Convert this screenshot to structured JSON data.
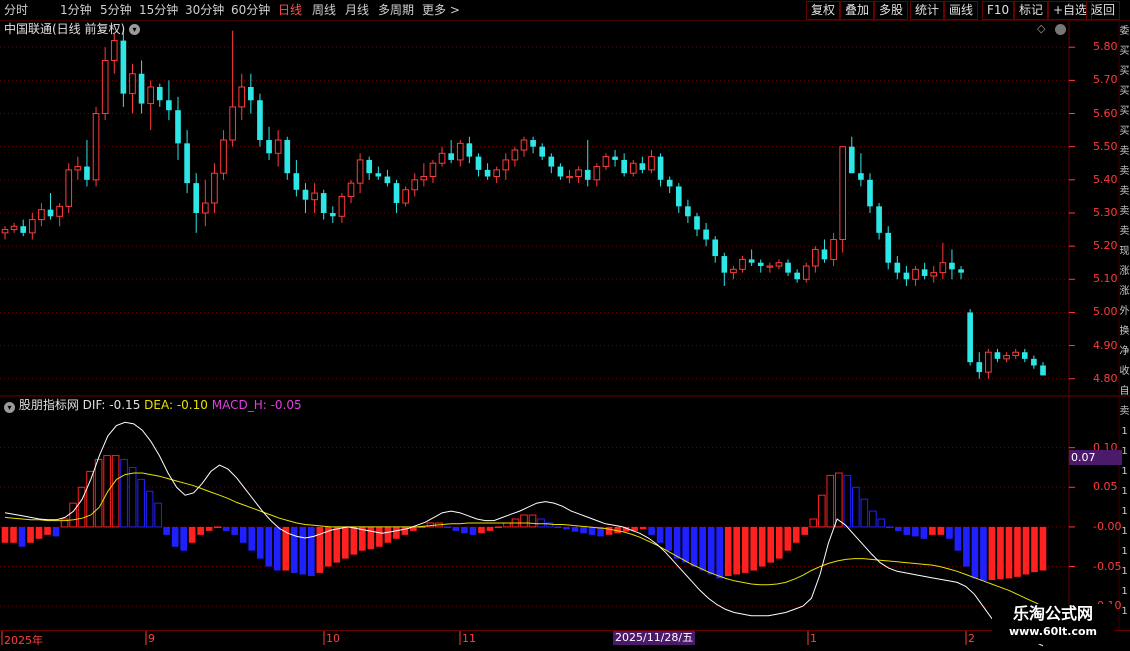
{
  "toolbar": {
    "periods": [
      "分时",
      "1分钟",
      "5分钟",
      "15分钟",
      "30分钟",
      "60分钟",
      "日线",
      "周线",
      "月线",
      "多周期",
      "更多 >"
    ],
    "active_period": "日线",
    "right_buttons": [
      "复权",
      "叠加",
      "多股",
      "统计",
      "画线",
      "F10",
      "标记",
      "+自选",
      "返回"
    ]
  },
  "stock": {
    "title": "中国联通(日线 前复权)"
  },
  "indicator": {
    "name": "股朋指标网",
    "dif_label": "DIF: -0.15",
    "dea_label": "DEA: -0.10",
    "macd_label": "MACD_H: -0.05",
    "current_value": "0.07"
  },
  "price_axis": {
    "ticks": [
      "5.80",
      "5.70",
      "5.60",
      "5.50",
      "5.40",
      "5.30",
      "5.20",
      "5.10",
      "5.00",
      "4.90",
      "4.80"
    ]
  },
  "macd_axis": {
    "ticks": [
      "0.10",
      "0.05",
      "-0.00",
      "-0.05",
      "-0.10"
    ]
  },
  "x_axis": {
    "labels": [
      "2025年",
      "9",
      "10",
      "11",
      "1",
      "2"
    ],
    "cursor_date": "2025/11/28/五"
  },
  "right_strip_chars": [
    "委",
    "买",
    "买",
    "买",
    "买",
    "买",
    "卖",
    "卖",
    "卖",
    "卖",
    "卖",
    "现",
    "涨",
    "涨",
    "外",
    "换",
    "净",
    "收",
    "自",
    "卖",
    "1",
    "1",
    "1",
    "1",
    "1",
    "1",
    "1",
    "1",
    "1",
    "1"
  ],
  "watermark": {
    "line1": "乐淘公式网",
    "line2": "www.60lt.com"
  },
  "colors": {
    "up": "#ff3b3b",
    "down": "#2de6e6",
    "macd_pos": "#ff2020",
    "macd_neg": "#2020ff",
    "dif": "#ffffff",
    "dea": "#e8e000",
    "grid": "#6a0000"
  },
  "chart_data": {
    "type": "candlestick",
    "price_range": [
      4.76,
      5.87
    ],
    "candles": [
      [
        5.24,
        5.26,
        5.22,
        5.25
      ],
      [
        5.25,
        5.27,
        5.24,
        5.26
      ],
      [
        5.26,
        5.28,
        5.23,
        5.24
      ],
      [
        5.24,
        5.3,
        5.22,
        5.28
      ],
      [
        5.28,
        5.33,
        5.26,
        5.31
      ],
      [
        5.31,
        5.36,
        5.28,
        5.29
      ],
      [
        5.29,
        5.33,
        5.26,
        5.32
      ],
      [
        5.32,
        5.45,
        5.3,
        5.43
      ],
      [
        5.43,
        5.47,
        5.4,
        5.44
      ],
      [
        5.44,
        5.52,
        5.38,
        5.4
      ],
      [
        5.4,
        5.62,
        5.38,
        5.6
      ],
      [
        5.6,
        5.8,
        5.58,
        5.76
      ],
      [
        5.76,
        5.84,
        5.72,
        5.82
      ],
      [
        5.82,
        5.85,
        5.62,
        5.66
      ],
      [
        5.66,
        5.75,
        5.6,
        5.72
      ],
      [
        5.72,
        5.76,
        5.6,
        5.63
      ],
      [
        5.63,
        5.7,
        5.55,
        5.68
      ],
      [
        5.68,
        5.69,
        5.62,
        5.64
      ],
      [
        5.64,
        5.7,
        5.58,
        5.61
      ],
      [
        5.61,
        5.65,
        5.46,
        5.51
      ],
      [
        5.51,
        5.55,
        5.36,
        5.39
      ],
      [
        5.39,
        5.42,
        5.24,
        5.3
      ],
      [
        5.3,
        5.4,
        5.26,
        5.33
      ],
      [
        5.33,
        5.45,
        5.3,
        5.42
      ],
      [
        5.42,
        5.55,
        5.4,
        5.52
      ],
      [
        5.52,
        5.85,
        5.5,
        5.62
      ],
      [
        5.62,
        5.72,
        5.58,
        5.68
      ],
      [
        5.68,
        5.72,
        5.6,
        5.64
      ],
      [
        5.64,
        5.66,
        5.5,
        5.52
      ],
      [
        5.52,
        5.56,
        5.46,
        5.48
      ],
      [
        5.48,
        5.55,
        5.44,
        5.52
      ],
      [
        5.52,
        5.53,
        5.4,
        5.42
      ],
      [
        5.42,
        5.46,
        5.35,
        5.37
      ],
      [
        5.37,
        5.39,
        5.3,
        5.34
      ],
      [
        5.34,
        5.39,
        5.3,
        5.36
      ],
      [
        5.36,
        5.37,
        5.28,
        5.3
      ],
      [
        5.3,
        5.32,
        5.27,
        5.29
      ],
      [
        5.29,
        5.36,
        5.27,
        5.35
      ],
      [
        5.35,
        5.4,
        5.33,
        5.39
      ],
      [
        5.39,
        5.48,
        5.36,
        5.46
      ],
      [
        5.46,
        5.47,
        5.4,
        5.42
      ],
      [
        5.42,
        5.44,
        5.4,
        5.41
      ],
      [
        5.41,
        5.43,
        5.38,
        5.39
      ],
      [
        5.39,
        5.4,
        5.3,
        5.33
      ],
      [
        5.33,
        5.38,
        5.32,
        5.37
      ],
      [
        5.37,
        5.42,
        5.35,
        5.4
      ],
      [
        5.4,
        5.45,
        5.38,
        5.41
      ],
      [
        5.41,
        5.46,
        5.39,
        5.45
      ],
      [
        5.45,
        5.5,
        5.44,
        5.48
      ],
      [
        5.48,
        5.52,
        5.45,
        5.46
      ],
      [
        5.46,
        5.52,
        5.44,
        5.51
      ],
      [
        5.51,
        5.53,
        5.45,
        5.47
      ],
      [
        5.47,
        5.48,
        5.41,
        5.43
      ],
      [
        5.43,
        5.45,
        5.4,
        5.41
      ],
      [
        5.41,
        5.44,
        5.39,
        5.43
      ],
      [
        5.43,
        5.48,
        5.4,
        5.46
      ],
      [
        5.46,
        5.5,
        5.44,
        5.49
      ],
      [
        5.49,
        5.53,
        5.47,
        5.52
      ],
      [
        5.52,
        5.53,
        5.48,
        5.5
      ],
      [
        5.5,
        5.51,
        5.46,
        5.47
      ],
      [
        5.47,
        5.48,
        5.42,
        5.44
      ],
      [
        5.44,
        5.45,
        5.4,
        5.41
      ],
      [
        5.41,
        5.43,
        5.39,
        5.41
      ],
      [
        5.41,
        5.44,
        5.39,
        5.43
      ],
      [
        5.43,
        5.52,
        5.38,
        5.4
      ],
      [
        5.4,
        5.45,
        5.38,
        5.44
      ],
      [
        5.44,
        5.48,
        5.43,
        5.47
      ],
      [
        5.47,
        5.49,
        5.44,
        5.46
      ],
      [
        5.46,
        5.48,
        5.41,
        5.42
      ],
      [
        5.42,
        5.46,
        5.41,
        5.45
      ],
      [
        5.45,
        5.47,
        5.42,
        5.43
      ],
      [
        5.43,
        5.49,
        5.42,
        5.47
      ],
      [
        5.47,
        5.48,
        5.38,
        5.4
      ],
      [
        5.4,
        5.41,
        5.36,
        5.38
      ],
      [
        5.38,
        5.39,
        5.3,
        5.32
      ],
      [
        5.32,
        5.34,
        5.27,
        5.29
      ],
      [
        5.29,
        5.3,
        5.23,
        5.25
      ],
      [
        5.25,
        5.27,
        5.2,
        5.22
      ],
      [
        5.22,
        5.23,
        5.15,
        5.17
      ],
      [
        5.17,
        5.18,
        5.08,
        5.12
      ],
      [
        5.12,
        5.14,
        5.1,
        5.13
      ],
      [
        5.13,
        5.17,
        5.12,
        5.16
      ],
      [
        5.16,
        5.19,
        5.14,
        5.15
      ],
      [
        5.15,
        5.16,
        5.12,
        5.14
      ],
      [
        5.14,
        5.15,
        5.12,
        5.14
      ],
      [
        5.14,
        5.16,
        5.13,
        5.15
      ],
      [
        5.15,
        5.16,
        5.11,
        5.12
      ],
      [
        5.12,
        5.13,
        5.09,
        5.1
      ],
      [
        5.1,
        5.15,
        5.09,
        5.14
      ],
      [
        5.14,
        5.2,
        5.12,
        5.19
      ],
      [
        5.19,
        5.22,
        5.15,
        5.16
      ],
      [
        5.16,
        5.24,
        5.14,
        5.22
      ],
      [
        5.22,
        5.35,
        5.18,
        5.5
      ],
      [
        5.5,
        5.53,
        5.44,
        5.42
      ],
      [
        5.42,
        5.48,
        5.38,
        5.4
      ],
      [
        5.4,
        5.42,
        5.3,
        5.32
      ],
      [
        5.32,
        5.33,
        5.22,
        5.24
      ],
      [
        5.24,
        5.26,
        5.13,
        5.15
      ],
      [
        5.15,
        5.17,
        5.1,
        5.12
      ],
      [
        5.12,
        5.14,
        5.08,
        5.1
      ],
      [
        5.1,
        5.14,
        5.08,
        5.13
      ],
      [
        5.13,
        5.15,
        5.1,
        5.11
      ],
      [
        5.11,
        5.14,
        5.09,
        5.12
      ],
      [
        5.12,
        5.21,
        5.1,
        5.15
      ],
      [
        5.15,
        5.19,
        5.1,
        5.13
      ],
      [
        5.13,
        5.14,
        5.1,
        5.12
      ],
      [
        5.0,
        5.01,
        4.84,
        4.85
      ],
      [
        4.85,
        4.88,
        4.8,
        4.82
      ],
      [
        4.82,
        4.89,
        4.8,
        4.88
      ],
      [
        4.88,
        4.89,
        4.85,
        4.86
      ],
      [
        4.86,
        4.88,
        4.85,
        4.87
      ],
      [
        4.87,
        4.89,
        4.86,
        4.88
      ],
      [
        4.88,
        4.89,
        4.85,
        4.86
      ],
      [
        4.86,
        4.87,
        4.83,
        4.84
      ],
      [
        4.84,
        4.85,
        4.81,
        4.81
      ]
    ],
    "macd_range": [
      -0.125,
      0.145
    ],
    "macd_h": [
      -0.02,
      -0.02,
      -0.025,
      -0.02,
      -0.015,
      -0.01,
      -0.012,
      0.01,
      0.03,
      0.05,
      0.07,
      0.085,
      0.09,
      0.09,
      0.085,
      0.075,
      0.06,
      0.045,
      0.03,
      -0.01,
      -0.025,
      -0.03,
      -0.02,
      -0.01,
      -0.005,
      0.0,
      -0.005,
      -0.01,
      -0.02,
      -0.03,
      -0.04,
      -0.05,
      -0.055,
      -0.055,
      -0.058,
      -0.06,
      -0.062,
      -0.058,
      -0.05,
      -0.045,
      -0.04,
      -0.035,
      -0.03,
      -0.028,
      -0.025,
      -0.02,
      -0.015,
      -0.01,
      -0.005,
      0.0,
      0.005,
      0.005,
      0.0,
      -0.005,
      -0.008,
      -0.01,
      -0.008,
      -0.005,
      0.0,
      0.005,
      0.01,
      0.015,
      0.015,
      0.01,
      0.005,
      0.0,
      -0.003,
      -0.006,
      -0.008,
      -0.01,
      -0.012,
      -0.01,
      -0.008,
      -0.006,
      -0.005,
      -0.003,
      -0.01,
      -0.02,
      -0.03,
      -0.04,
      -0.045,
      -0.05,
      -0.055,
      -0.06,
      -0.065,
      -0.062,
      -0.06,
      -0.058,
      -0.055,
      -0.05,
      -0.045,
      -0.04,
      -0.03,
      -0.02,
      -0.01,
      0.01,
      0.04,
      0.065,
      0.068,
      0.065,
      0.05,
      0.035,
      0.02,
      0.01,
      0.0,
      -0.005,
      -0.01,
      -0.012,
      -0.015,
      -0.01,
      -0.01,
      -0.015,
      -0.03,
      -0.05,
      -0.065,
      -0.068,
      -0.067,
      -0.066,
      -0.065,
      -0.063,
      -0.06,
      -0.057,
      -0.055
    ],
    "dif": [
      0.018,
      0.016,
      0.014,
      0.012,
      0.01,
      0.009,
      0.009,
      0.012,
      0.02,
      0.035,
      0.06,
      0.09,
      0.115,
      0.128,
      0.132,
      0.13,
      0.122,
      0.108,
      0.09,
      0.068,
      0.05,
      0.04,
      0.043,
      0.055,
      0.07,
      0.078,
      0.073,
      0.062,
      0.048,
      0.034,
      0.02,
      0.008,
      -0.002,
      -0.008,
      -0.012,
      -0.014,
      -0.012,
      -0.008,
      -0.004,
      -0.002,
      0.0,
      -0.002,
      -0.004,
      -0.006,
      -0.008,
      -0.006,
      -0.004,
      -0.002,
      0.002,
      0.006,
      0.012,
      0.018,
      0.02,
      0.018,
      0.014,
      0.01,
      0.008,
      0.008,
      0.012,
      0.016,
      0.02,
      0.025,
      0.03,
      0.032,
      0.03,
      0.026,
      0.02,
      0.016,
      0.012,
      0.008,
      0.004,
      0.002,
      0.0,
      -0.004,
      -0.008,
      -0.014,
      -0.022,
      -0.032,
      -0.044,
      -0.056,
      -0.068,
      -0.08,
      -0.09,
      -0.098,
      -0.104,
      -0.108,
      -0.11,
      -0.112,
      -0.112,
      -0.112,
      -0.11,
      -0.108,
      -0.104,
      -0.1,
      -0.09,
      -0.06,
      -0.02,
      0.01,
      0.002,
      -0.01,
      -0.022,
      -0.034,
      -0.045,
      -0.052,
      -0.056,
      -0.058,
      -0.06,
      -0.062,
      -0.064,
      -0.066,
      -0.068,
      -0.07,
      -0.075,
      -0.085,
      -0.1,
      -0.115,
      -0.125,
      -0.13,
      -0.135,
      -0.14,
      -0.145,
      -0.15
    ],
    "dea": [
      0.012,
      0.011,
      0.01,
      0.009,
      0.009,
      0.008,
      0.008,
      0.008,
      0.009,
      0.011,
      0.015,
      0.025,
      0.045,
      0.06,
      0.066,
      0.068,
      0.068,
      0.066,
      0.064,
      0.061,
      0.058,
      0.055,
      0.052,
      0.048,
      0.044,
      0.04,
      0.036,
      0.031,
      0.027,
      0.023,
      0.019,
      0.015,
      0.011,
      0.008,
      0.005,
      0.003,
      0.002,
      0.001,
      0.0,
      0.0,
      0.0,
      0.0,
      0.0,
      0.0,
      0.0,
      0.0,
      0.0,
      0.0,
      0.0,
      0.001,
      0.002,
      0.003,
      0.004,
      0.004,
      0.005,
      0.005,
      0.005,
      0.005,
      0.005,
      0.005,
      0.005,
      0.005,
      0.004,
      0.004,
      0.003,
      0.003,
      0.002,
      0.001,
      0.0,
      -0.001,
      -0.002,
      -0.004,
      -0.006,
      -0.009,
      -0.013,
      -0.018,
      -0.023,
      -0.029,
      -0.035,
      -0.041,
      -0.047,
      -0.052,
      -0.057,
      -0.061,
      -0.065,
      -0.068,
      -0.07,
      -0.072,
      -0.073,
      -0.073,
      -0.072,
      -0.07,
      -0.066,
      -0.061,
      -0.055,
      -0.05,
      -0.046,
      -0.043,
      -0.041,
      -0.04,
      -0.04,
      -0.041,
      -0.042,
      -0.043,
      -0.044,
      -0.045,
      -0.046,
      -0.047,
      -0.048,
      -0.05,
      -0.053,
      -0.056,
      -0.06,
      -0.064,
      -0.068,
      -0.072,
      -0.076,
      -0.08,
      -0.085,
      -0.09,
      -0.095,
      -0.1
    ]
  }
}
